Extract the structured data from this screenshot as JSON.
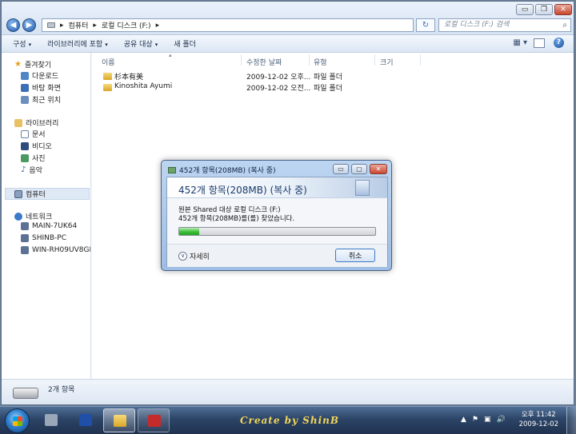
{
  "window": {
    "controls": {
      "minimize": "▭",
      "maximize": "❐",
      "close": "✕"
    }
  },
  "address_bar": {
    "back": "◀",
    "forward": "▶",
    "sep": "▸",
    "path": [
      "컴퓨터",
      "로컬 디스크 (F:)"
    ],
    "refresh": "↻",
    "search_placeholder": "로컬 디스크 (F:) 검색",
    "search_icon": "⌕"
  },
  "toolbar": {
    "caret": "▾",
    "items": [
      "구성",
      "라이브러리에 포함",
      "공유 대상",
      "새 폴더"
    ],
    "view": "▦ ▾",
    "help": "?"
  },
  "nav": {
    "favorites": {
      "label": "즐겨찾기",
      "items": [
        "다운로드",
        "바탕 화면",
        "최근 위치"
      ]
    },
    "libraries": {
      "label": "라이브러리",
      "items": [
        "문서",
        "비디오",
        "사진",
        "음악"
      ]
    },
    "computer": {
      "label": "컴퓨터"
    },
    "network": {
      "label": "네트워크",
      "items": [
        "MAIN-7UK64",
        "SHINB-PC",
        "WIN-RH09UV8GDE"
      ]
    },
    "icons": {
      "star": "★",
      "music": "♪"
    }
  },
  "content": {
    "columns": [
      "이름",
      "수정한 날짜",
      "유형",
      "크기"
    ],
    "sort_arrow": "▴",
    "rows": [
      {
        "name": "杉本有美",
        "date": "2009-12-02 오후...",
        "type": "파일 폴더",
        "size": ""
      },
      {
        "name": "Kinoshita Ayumi",
        "date": "2009-12-02 오전...",
        "type": "파일 폴더",
        "size": ""
      }
    ]
  },
  "details": {
    "count": "2개 항목"
  },
  "dialog": {
    "title": "452개 항목(208MB) (복사 중)",
    "heading": "452개 항목(208MB) (복사 중)",
    "line1": "원본 Shared 대상 로컬 디스크 (F:)",
    "line2": "452개 항목(208MB)를(를) 찾았습니다.",
    "progress": 0.1,
    "more_details": "자세히",
    "more_icon": "∨",
    "cancel": "취소",
    "controls": {
      "minimize": "▭",
      "maximize": "▢",
      "close": "✕"
    }
  },
  "taskbar": {
    "watermark": "Create by ShinB",
    "tray": [
      "▲",
      "⚑",
      "▣",
      "🔊"
    ],
    "time": "오후 11:42",
    "date": "2009-12-02"
  },
  "colors": {
    "accent": "#2f7fce",
    "progress": "#3fbf3b",
    "watermark": "#f3d65a"
  }
}
